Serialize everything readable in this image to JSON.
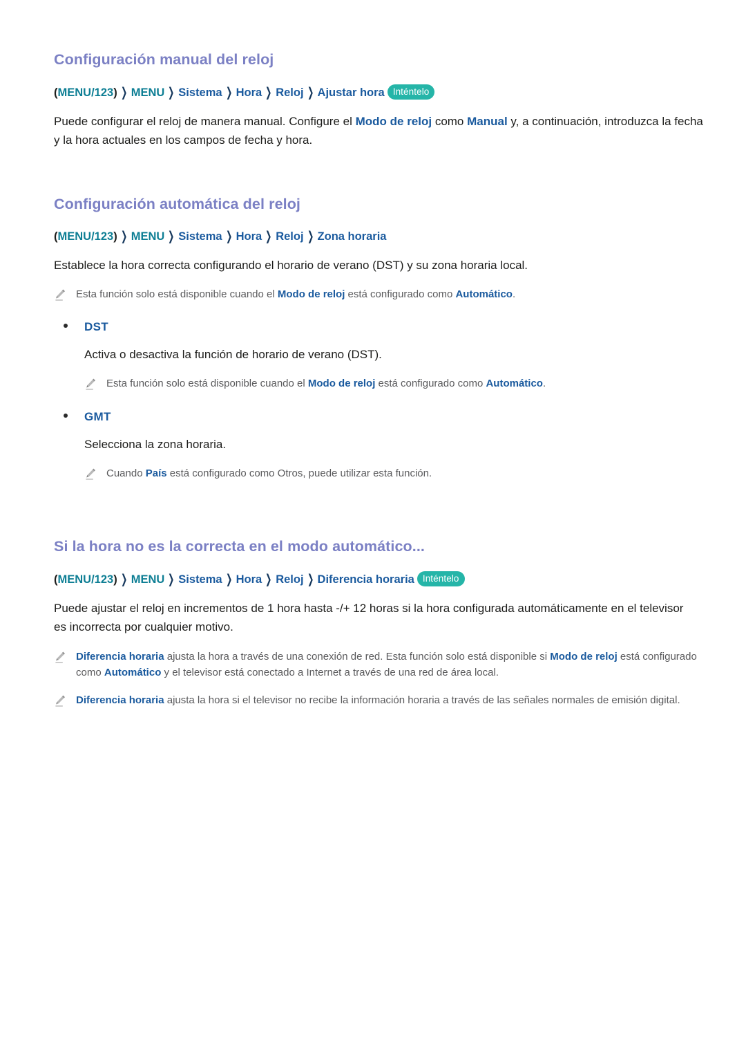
{
  "page": {
    "background": "#ffffff",
    "heading_color": "#7b80c4",
    "accent_teal": "#0d7e94",
    "accent_blue": "#1a5a9e",
    "badge_color": "#25b5a8",
    "note_text_color": "#5a5a5c"
  },
  "sections": [
    {
      "heading": "Configuración manual del reloj",
      "breadcrumb": {
        "open_paren": "(",
        "root": "MENU/123",
        "close_paren": ")",
        "separator": "❯",
        "items": [
          "MENU",
          "Sistema",
          "Hora",
          "Reloj",
          "Ajustar hora"
        ],
        "badge": "Inténtelo"
      },
      "body": {
        "p1_a": "Puede configurar el reloj de manera manual. Configure el ",
        "p1_b": "Modo de reloj",
        "p1_c": " como ",
        "p1_d": "Manual",
        "p1_e": " y, a continuación, introduzca la fecha y la hora actuales en los campos de fecha y hora."
      }
    },
    {
      "heading": "Configuración automática del reloj",
      "breadcrumb": {
        "open_paren": "(",
        "root": "MENU/123",
        "close_paren": ")",
        "separator": "❯",
        "items": [
          "MENU",
          "Sistema",
          "Hora",
          "Reloj",
          "Zona horaria"
        ],
        "badge": ""
      },
      "body": {
        "p1": "Establece la hora correcta configurando el horario de verano (DST) y su zona horaria local."
      },
      "note1": {
        "a": "Esta función solo está disponible cuando el ",
        "b": "Modo de reloj",
        "c": " está configurado como ",
        "d": "Automático",
        "e": "."
      },
      "bullets": [
        {
          "label": "DST",
          "description": "Activa o desactiva la función de horario de verano (DST).",
          "note": {
            "a": "Esta función solo está disponible cuando el ",
            "b": "Modo de reloj",
            "c": " está configurado como ",
            "d": "Automático",
            "e": "."
          }
        },
        {
          "label": "GMT",
          "description": "Selecciona la zona horaria.",
          "note": {
            "a": "Cuando ",
            "b": "País",
            "c": " está configurado como Otros, puede utilizar esta función.",
            "d": "",
            "e": ""
          }
        }
      ]
    },
    {
      "heading": "Si la hora no es la correcta en el modo automático...",
      "breadcrumb": {
        "open_paren": "(",
        "root": "MENU/123",
        "close_paren": ")",
        "separator": "❯",
        "items": [
          "MENU",
          "Sistema",
          "Hora",
          "Reloj",
          "Diferencia horaria"
        ],
        "badge": "Inténtelo"
      },
      "body": {
        "p1": "Puede ajustar el reloj en incrementos de 1 hora hasta -/+ 12 horas si la hora configurada automáticamente en el televisor es incorrecta por cualquier motivo."
      },
      "notes": [
        {
          "a": "Diferencia horaria",
          "b": " ajusta la hora a través de una conexión de red. Esta función solo está disponible si ",
          "c": "Modo de reloj",
          "d": " está configurado como ",
          "e": "Automático",
          "f": " y el televisor está conectado a Internet a través de una red de área local."
        },
        {
          "a": "Diferencia horaria",
          "b": " ajusta la hora si el televisor no recibe la información horaria a través de las señales normales de emisión digital.",
          "c": "",
          "d": "",
          "e": "",
          "f": ""
        }
      ]
    }
  ],
  "icons": {
    "note": "pencil-icon",
    "bullet": "bullet-dot-icon",
    "separator": "chevron-right-icon"
  }
}
